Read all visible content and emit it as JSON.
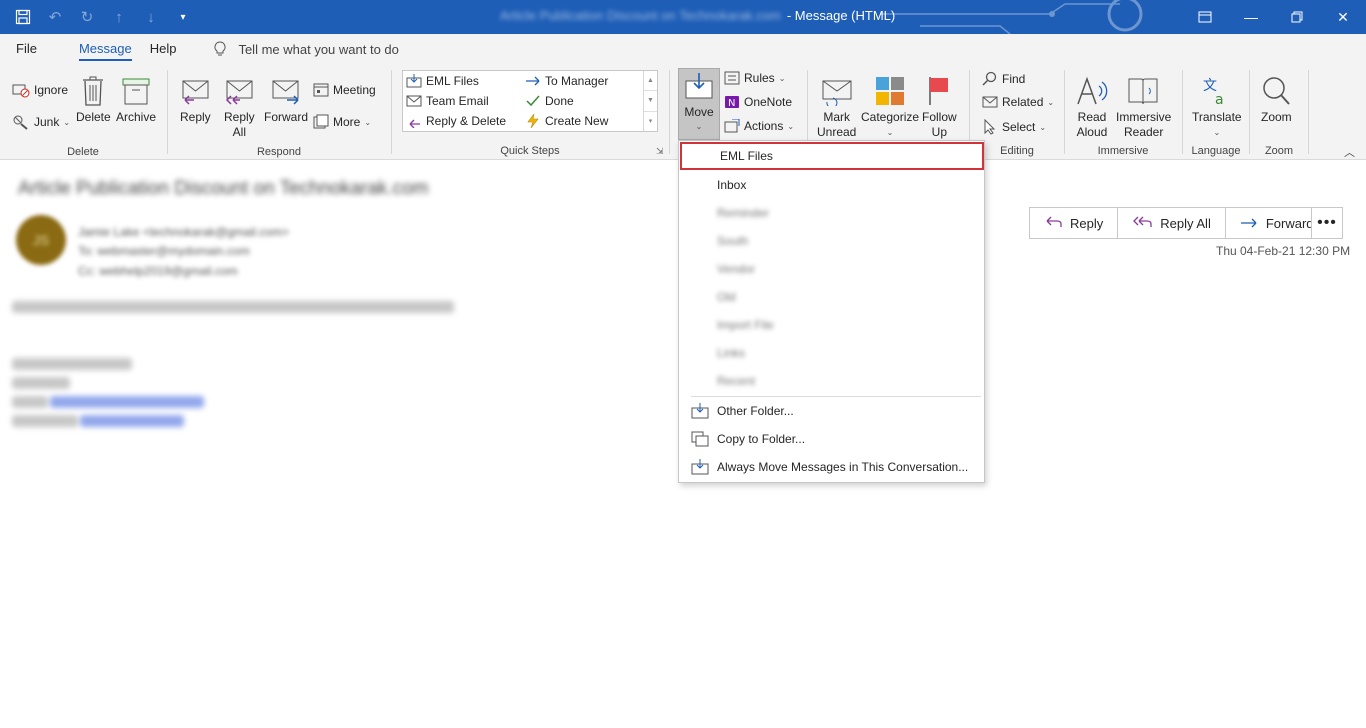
{
  "window": {
    "title_subject": "Article Publication Discount on Technokarak.com",
    "title_suffix": "- Message (HTML)"
  },
  "tabs": [
    "File",
    "Message",
    "Help"
  ],
  "tell_me": "Tell me what you want to do",
  "ribbon": {
    "delete_group": {
      "label": "Delete",
      "ignore": "Ignore",
      "junk": "Junk",
      "delete": "Delete",
      "archive": "Archive"
    },
    "respond_group": {
      "label": "Respond",
      "reply": "Reply",
      "reply_all_1": "Reply",
      "reply_all_2": "All",
      "forward": "Forward",
      "meeting": "Meeting",
      "more": "More"
    },
    "quick_steps": {
      "label": "Quick Steps",
      "eml_files": "EML Files",
      "team_email": "Team Email",
      "reply_delete": "Reply & Delete",
      "to_manager": "To Manager",
      "done": "Done",
      "create_new": "Create New"
    },
    "move_group": {
      "move": "Move",
      "rules": "Rules",
      "onenote": "OneNote",
      "actions": "Actions"
    },
    "tags_group": {
      "mark_unread_1": "Mark",
      "mark_unread_2": "Unread",
      "categorize": "Categorize",
      "follow_up_1": "Follow",
      "follow_up_2": "Up"
    },
    "editing_group": {
      "label": "Editing",
      "find": "Find",
      "related": "Related",
      "select": "Select"
    },
    "immersive_group": {
      "label": "Immersive",
      "read_aloud_1": "Read",
      "read_aloud_2": "Aloud",
      "immersive_reader_1": "Immersive",
      "immersive_reader_2": "Reader"
    },
    "language_group": {
      "label": "Language",
      "translate": "Translate"
    },
    "zoom_group": {
      "label": "Zoom",
      "zoom": "Zoom"
    }
  },
  "message": {
    "subject": "Article Publication Discount on Technokarak.com",
    "avatar_initials": "JS",
    "sender": "Jamie Lake <technokarak@gmail.com>",
    "to": "To: webmaster@mydomain.com",
    "cc": "Cc: webhelp2019@gmail.com",
    "date": "Thu 04-Feb-21 12:30 PM",
    "actions": {
      "reply": "Reply",
      "reply_all": "Reply All",
      "forward": "Forward"
    }
  },
  "move_menu": {
    "items": [
      "EML Files",
      "Inbox"
    ],
    "blurred_items": [
      "Reminder",
      "South",
      "Vendor",
      "Old",
      "Import File",
      "Links",
      "Recent"
    ],
    "other_folder": "Other Folder...",
    "copy_to_folder": "Copy to Folder...",
    "always_move": "Always Move Messages in This Conversation..."
  },
  "colors": {
    "titlebar": "#1e5eb7",
    "highlight_border": "#d13438",
    "accent": "#1e5eb7"
  }
}
